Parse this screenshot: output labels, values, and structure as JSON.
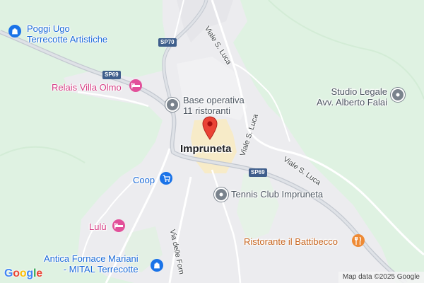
{
  "map": {
    "town_name": "Impruneta",
    "attribution": "Map data ©2025 Google",
    "logo_text": "Google",
    "logo_letters": [
      {
        "ch": "G",
        "color": "#4285F4"
      },
      {
        "ch": "o",
        "color": "#EA4335"
      },
      {
        "ch": "o",
        "color": "#FBBC05"
      },
      {
        "ch": "g",
        "color": "#4285F4"
      },
      {
        "ch": "l",
        "color": "#34A853"
      },
      {
        "ch": "e",
        "color": "#EA4335"
      }
    ],
    "colors": {
      "background_green": "#dff2e2",
      "urban_gray": "#ececef",
      "town_center": "#f7ebc8",
      "road": "#ffffff",
      "major_road": "#c9ced6",
      "marker_red": "#ea4335"
    }
  },
  "roads": {
    "sp70": "SP70",
    "sp69_west": "SP69",
    "sp69_east": "SP69",
    "viale_s_luca_north": "Viale S. Luca",
    "viale_s_luca_center": "Viale S. Luca",
    "viale_s_luca_east": "Viale S. Luca",
    "via_delle_fornaci": "Via delle Forn"
  },
  "pois": {
    "poggi_ugo": {
      "line1": "Poggi Ugo",
      "line2": "Terrecotte Artistiche",
      "icon": "shopping-bag-icon"
    },
    "relais_villa_olmo": {
      "label": "Relais Villa Olmo",
      "icon": "bed-icon"
    },
    "base_operativa": {
      "line1": "Base operativa",
      "line2": "11 ristoranti",
      "icon": "place-dot-icon"
    },
    "studio_legale": {
      "line1": "Studio Legale",
      "line2": "Avv. Alberto Falai",
      "icon": "place-dot-icon"
    },
    "coop": {
      "label": "Coop",
      "icon": "shopping-cart-icon"
    },
    "tennis_club": {
      "label": "Tennis Club Impruneta",
      "icon": "place-dot-icon"
    },
    "lulu": {
      "label": "Lulù",
      "icon": "bed-icon"
    },
    "antica_fornace": {
      "line1": "Antica Fornace Mariani",
      "line2": "- MITAL Terrecotte",
      "icon": "shopping-bag-icon"
    },
    "ristorante": {
      "label": "Ristorante il Battibecco",
      "icon": "fork-knife-icon"
    }
  }
}
